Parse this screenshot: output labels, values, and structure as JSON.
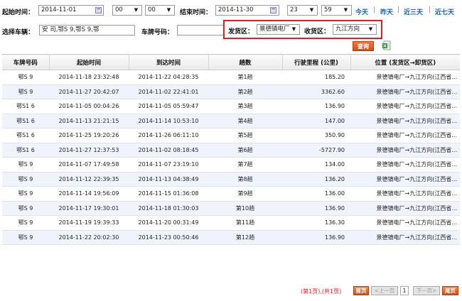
{
  "filters": {
    "start_label": "起始时间：",
    "start_date": "2014-11-01",
    "start_hour": "00",
    "start_min": "00",
    "end_label": "结束时间：",
    "end_date": "2014-11-30",
    "end_hour": "23",
    "end_min": "59",
    "quick": [
      "今天",
      "昨天",
      "近三天",
      "近七天"
    ],
    "quick_sep": "|",
    "vehicle_label": "选择车辆：",
    "vehicle_value": "安      司,鄂S      9,鄂S      9,鄂",
    "plate_label": "车牌号码：",
    "plate_value": "",
    "origin_label": "发货区：",
    "origin_value": "景德镇电厂",
    "dest_label": "收货区：",
    "dest_value": "九江方向",
    "query_label": "查询",
    "accent": "#e02020"
  },
  "table": {
    "headers": [
      "车牌号码",
      "起始时间",
      "到达时间",
      "趟数",
      "行驶里程 (公里)",
      "位置 (发货区→卸货区)"
    ],
    "rows": [
      [
        "鄂S     9",
        "2014-11-18 23:32:48",
        "2014-11-22 04:28:35",
        "第1趟",
        "185.20",
        "景德镇电厂→九江方向(江西省..."
      ],
      [
        "鄂S     9",
        "2014-11-27 20:42:07",
        "2014-11-02 22:41:01",
        "第2趟",
        "3362.60",
        "景德镇电厂→九江方向(江西省..."
      ],
      [
        "鄂S1    6",
        "2014-11-05 00:04:26",
        "2014-11-05 05:59:47",
        "第3趟",
        "136.90",
        "景德镇电厂→九江方向(江西省..."
      ],
      [
        "鄂S1    6",
        "2014-11-13 21:21:15",
        "2014-11-14 10:53:10",
        "第4趟",
        "147.00",
        "景德镇电厂→九江方向(江西省..."
      ],
      [
        "鄂S1    6",
        "2014-11-25 19:20:26",
        "2014-11-26 06:11:10",
        "第5趟",
        "350.90",
        "景德镇电厂→九江方向(江西省..."
      ],
      [
        "鄂S1    6",
        "2014-11-27 12:37:53",
        "2014-11-02 08:18:45",
        "第6趟",
        "-5727.90",
        "景德镇电厂→九江方向(江西省..."
      ],
      [
        "鄂S     9",
        "2014-11-07 17:49:58",
        "2014-11-07 23:19:10",
        "第7趟",
        "134.00",
        "景德镇电厂→九江方向(江西省..."
      ],
      [
        "鄂S     9",
        "2014-11-12 22:39:35",
        "2014-11-13 04:38:49",
        "第8趟",
        "136.20",
        "景德镇电厂→九江方向(江西省..."
      ],
      [
        "鄂S     9",
        "2014-11-14 19:56:09",
        "2014-11-15 01:36:08",
        "第9趟",
        "136.00",
        "景德镇电厂→九江方向(江西省..."
      ],
      [
        "鄂S     9",
        "2014-11-17 19:30:01",
        "2014-11-18 01:30:03",
        "第10趟",
        "136.90",
        "景德镇电厂→九江方向(江西省..."
      ],
      [
        "鄂S     9",
        "2014-11-19 19:39:33",
        "2014-11-20 00:31:49",
        "第11趟",
        "136.30",
        "景德镇电厂→九江方向(江西省..."
      ],
      [
        "鄂S     9",
        "2014-11-22 20:02:30",
        "2014-11-23 00:50:46",
        "第12趟",
        "136.90",
        "景德镇电厂→九江方向(江西省..."
      ]
    ]
  },
  "pager": {
    "info": "(第1页),(共1页)",
    "first": "首页",
    "prev": "<上一页",
    "current": "1",
    "next": "下一页>",
    "last": "尾页"
  }
}
